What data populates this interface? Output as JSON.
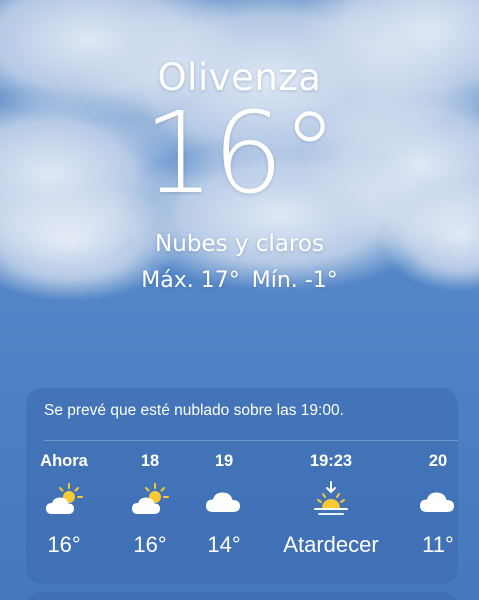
{
  "location": {
    "city": "Olivenza",
    "temperature": "16°",
    "condition": "Nubes y claros",
    "high": "Máx. 17°",
    "low": "Mín. -1°"
  },
  "forecast_card": {
    "summary": "Se prevé que esté nublado sobre las 19:00.",
    "hours": [
      {
        "label": "Ahora",
        "icon": "partly-sunny-icon",
        "value": "16°"
      },
      {
        "label": "18",
        "icon": "partly-sunny-icon",
        "value": "16°"
      },
      {
        "label": "19",
        "icon": "cloud-icon",
        "value": "14°"
      },
      {
        "label": "19:23",
        "icon": "sunset-icon",
        "value": "Atardecer"
      },
      {
        "label": "20",
        "icon": "cloud-icon",
        "value": "11°"
      }
    ]
  },
  "colors": {
    "sun": "#f7c934",
    "cloud": "#ffffff",
    "card_bg": "rgba(60,105,175,0.55)"
  }
}
